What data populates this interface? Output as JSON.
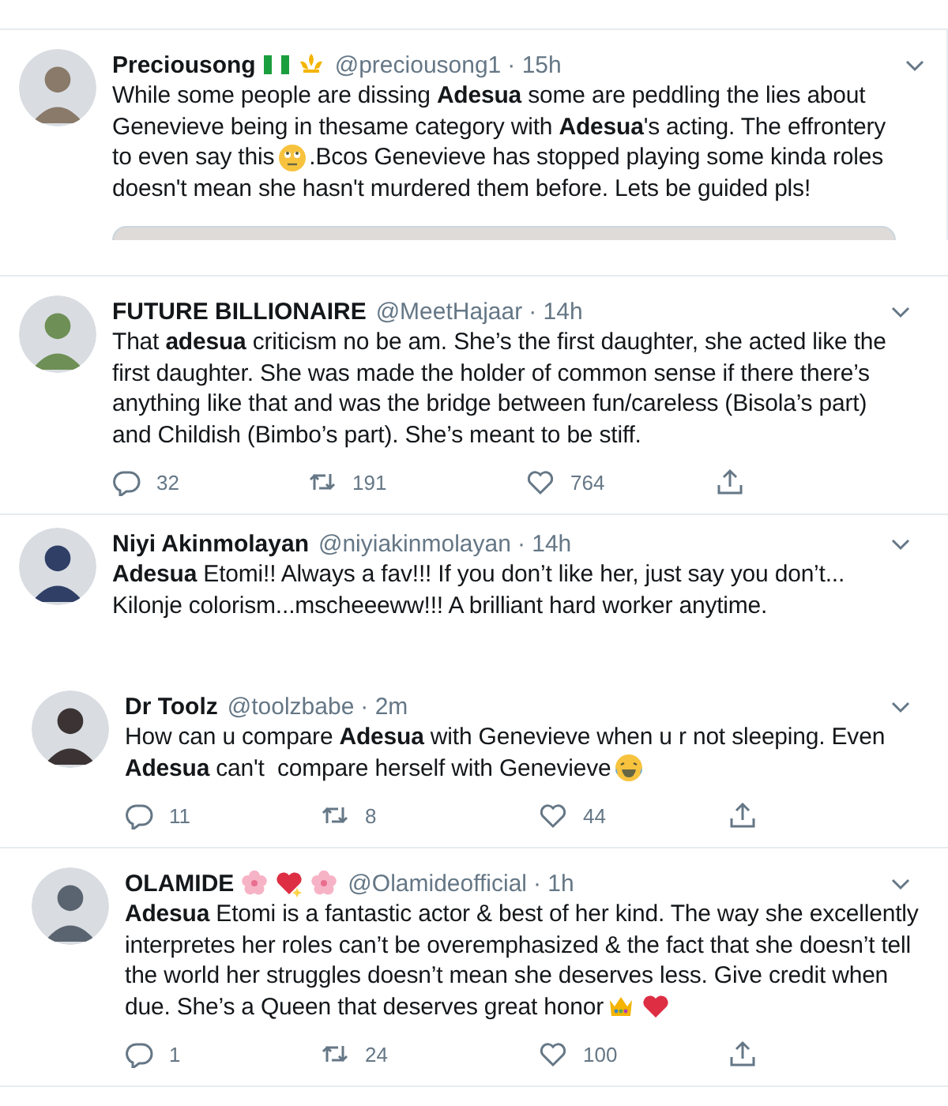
{
  "tweets": [
    {
      "name": "Preciousong",
      "name_badges": [
        {
          "kind": "flag"
        },
        {
          "kind": "fleur"
        }
      ],
      "handle": "@preciousong1",
      "time": "· 15h",
      "lines": [
        [
          {
            "kind": "text",
            "text": "While some people are dissing **Adesua** some are peddling the lies about"
          }
        ],
        [
          {
            "kind": "text",
            "text": "Genevieve being in thesame category with **Adesua**'s acting. The effrontery"
          }
        ],
        [
          {
            "kind": "text",
            "text": "to even say this"
          },
          {
            "kind": "eye-roll"
          },
          {
            "kind": "text",
            "text": ".Bcos Genevieve has stopped playing some kinda roles"
          }
        ],
        [
          {
            "kind": "text",
            "text": "doesn't mean she hasn't murdered them before. Lets be guided pls!"
          }
        ]
      ],
      "media": true
    },
    {
      "name": "FUTURE BILLIONAIRE",
      "handle": "@MeetHajaar",
      "time": "· 14h",
      "lines": [
        [
          {
            "kind": "text",
            "text": "That **adesua** criticism no be am. She’s the first daughter, she acted like the"
          }
        ],
        [
          {
            "kind": "text",
            "text": "first daughter. She was made the holder of common sense if there there’s"
          }
        ],
        [
          {
            "kind": "text",
            "text": "anything like that and was the bridge between fun/careless (Bisola’s part)"
          }
        ],
        [
          {
            "kind": "text",
            "text": "and Childish (Bimbo’s part). She’s meant to be stiff."
          }
        ]
      ],
      "actions": {
        "replies": "32",
        "retweets": "191",
        "likes": "764"
      }
    },
    {
      "name": "Niyi Akinmolayan",
      "handle": "@niyiakinmolayan",
      "time": "· 14h",
      "lines": [
        [
          {
            "kind": "text",
            "text": "**Adesua** Etomi!! Always a fav!!! If you don’t like her, just say you don’t..."
          }
        ],
        [
          {
            "kind": "text",
            "text": "Kilonje colorism...mscheeeww!!! A brilliant hard worker anytime."
          }
        ]
      ]
    },
    {
      "name": "Dr Toolz",
      "handle": "@toolzbabe",
      "time": "· 2m",
      "lines": [
        [
          {
            "kind": "text",
            "text": "How can u compare **Adesua** with Genevieve when u r not sleeping. Even"
          }
        ],
        [
          {
            "kind": "text",
            "text": "**Adesua** can't  compare herself with Genevieve"
          },
          {
            "kind": "laughing"
          }
        ]
      ],
      "actions": {
        "replies": "11",
        "retweets": "8",
        "likes": "44"
      }
    },
    {
      "name": "OLAMIDE",
      "name_badges": [
        {
          "kind": "blossom"
        },
        {
          "kind": "sparkle-heart"
        },
        {
          "kind": "blossom"
        }
      ],
      "handle": "@Olamideofficial",
      "time": "· 1h",
      "lines": [
        [
          {
            "kind": "text",
            "text": "**Adesua** Etomi is a fantastic actor & best of her kind. The way she excellently"
          }
        ],
        [
          {
            "kind": "text",
            "text": "interpretes her roles can’t be overemphasized & the fact that she doesn’t tell"
          }
        ],
        [
          {
            "kind": "text",
            "text": "the world her struggles doesn’t mean she deserves less. Give credit when"
          }
        ],
        [
          {
            "kind": "text",
            "text": "due. She’s a Queen that deserves great honor"
          },
          {
            "kind": "crown"
          },
          {
            "kind": "heart"
          }
        ]
      ],
      "actions": {
        "replies": "1",
        "retweets": "24",
        "likes": "100"
      }
    }
  ]
}
